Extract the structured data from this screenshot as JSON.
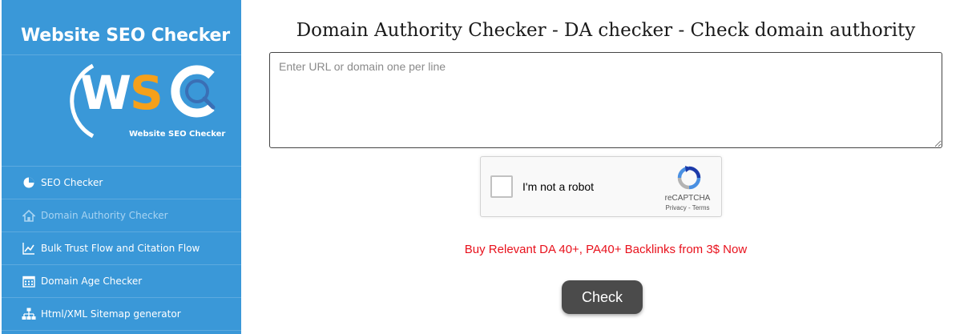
{
  "sidebar": {
    "brand_title": "Website SEO Checker",
    "logo_caption": "Website SEO Checker",
    "items": [
      {
        "label": "SEO Checker",
        "icon": "pie-chart-icon"
      },
      {
        "label": "Domain Authority Checker",
        "icon": "home-icon",
        "active": true
      },
      {
        "label": "Bulk Trust Flow and Citation Flow",
        "icon": "trend-chart-icon"
      },
      {
        "label": "Domain Age Checker",
        "icon": "calendar-icon"
      },
      {
        "label": "Html/XML Sitemap generator",
        "icon": "sitemap-icon"
      }
    ]
  },
  "main": {
    "title": "Domain Authority Checker - DA checker - Check domain authority",
    "url_input_placeholder": "Enter URL or domain one per line",
    "url_input_value": "",
    "captcha": {
      "label": "I'm not a robot",
      "brand": "reCAPTCHA",
      "links": "Privacy - Terms"
    },
    "promo_link": "Buy Relevant DA 40+, PA40+ Backlinks from 3$ Now",
    "check_button": "Check"
  },
  "colors": {
    "sidebar_bg": "#3a98d8",
    "promo_text": "#e8111c",
    "button_bg": "#4b4b4b",
    "logo_orange": "#f5a01a"
  }
}
